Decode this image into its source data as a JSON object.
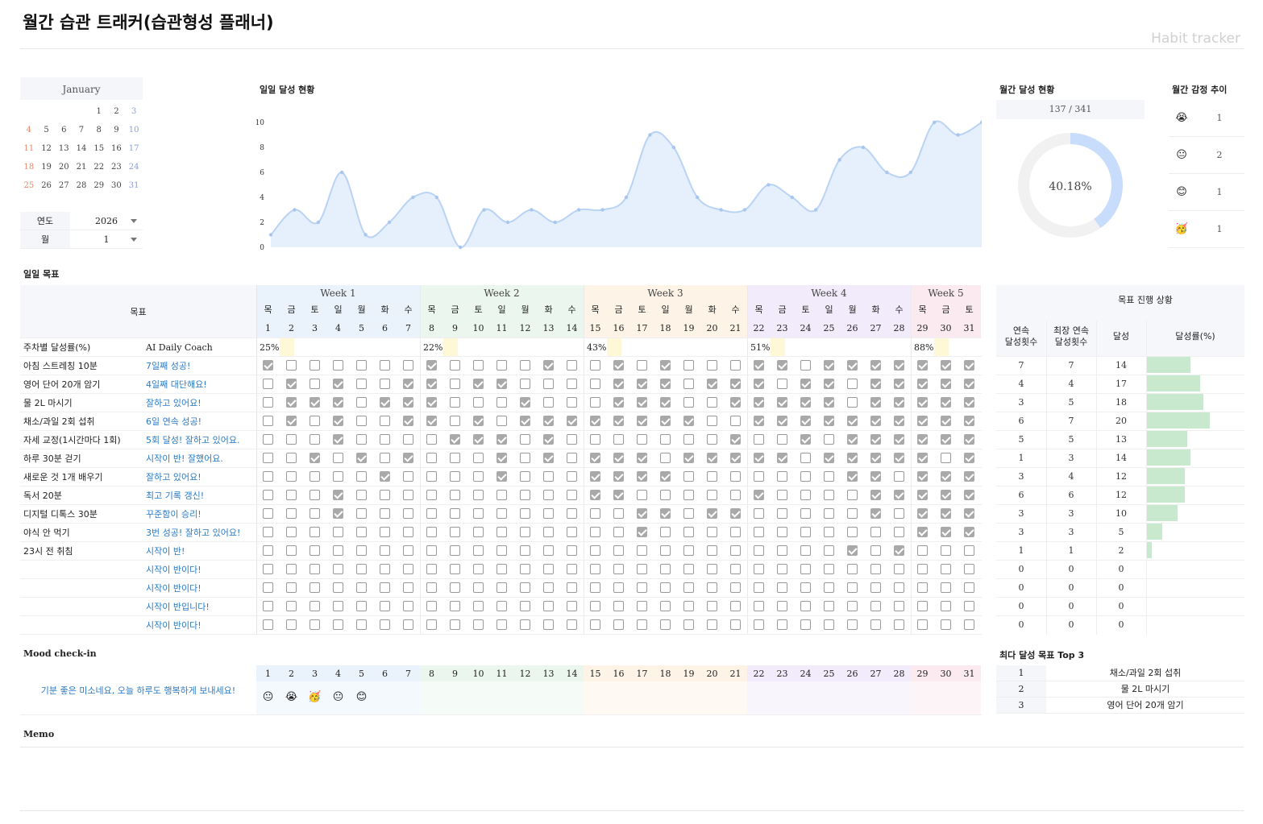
{
  "header": {
    "title": "월간 습관 트래커(습관형성 플래너)",
    "brand": "Habit tracker"
  },
  "calendar": {
    "month": "January",
    "days": [
      "",
      "",
      "",
      "",
      "1",
      "2",
      "3",
      "4",
      "5",
      "6",
      "7",
      "8",
      "9",
      "10",
      "11",
      "12",
      "13",
      "14",
      "15",
      "16",
      "17",
      "18",
      "19",
      "20",
      "21",
      "22",
      "23",
      "24",
      "25",
      "26",
      "27",
      "28",
      "29",
      "30",
      "31"
    ],
    "year_label": "연도",
    "year": "2026",
    "month_label": "월",
    "month_num": "1"
  },
  "daily_chart_title": "일일 달성 현황",
  "monthly_title": "월간 달성 현황",
  "monthly_count": "137 / 341",
  "monthly_percent": "40.18%",
  "monthly_fraction": 0.4018,
  "mood_trend_title": "월간 감정 추이",
  "mood_trend": [
    {
      "icon": "crying-face-icon",
      "emoji": "😭",
      "count": "1"
    },
    {
      "icon": "neutral-face-icon",
      "emoji": "😐",
      "count": "2"
    },
    {
      "icon": "smiling-face-icon",
      "emoji": "😊",
      "count": "1"
    },
    {
      "icon": "party-face-icon",
      "emoji": "🥳",
      "count": "1"
    }
  ],
  "chart_data": {
    "type": "area",
    "x": [
      1,
      2,
      3,
      4,
      5,
      6,
      7,
      8,
      9,
      10,
      11,
      12,
      13,
      14,
      15,
      16,
      17,
      18,
      19,
      20,
      21,
      22,
      23,
      24,
      25,
      26,
      27,
      28,
      29,
      30,
      31
    ],
    "values": [
      1,
      3,
      2,
      6,
      1,
      2,
      4,
      4,
      0,
      3,
      2,
      3,
      2,
      3,
      3,
      4,
      9,
      8,
      4,
      3,
      3,
      5,
      4,
      3,
      7,
      8,
      6,
      6,
      10,
      9,
      10
    ],
    "ylim": [
      0,
      10
    ],
    "yticks": [
      "0",
      "2",
      "4",
      "6",
      "8",
      "10"
    ],
    "color": "#b9d3f5",
    "fill": "#e6effc"
  },
  "daily_goals_title": "일일 목표",
  "goal_header": "목표",
  "weeks": [
    {
      "label": "Week 1",
      "color": "#eaf3fc",
      "days": [
        "1",
        "2",
        "3",
        "4",
        "5",
        "6",
        "7"
      ],
      "wd": [
        "목",
        "금",
        "토",
        "일",
        "월",
        "화",
        "수"
      ],
      "rate": "25%"
    },
    {
      "label": "Week 2",
      "color": "#ebf7ee",
      "days": [
        "8",
        "9",
        "10",
        "11",
        "12",
        "13",
        "14"
      ],
      "wd": [
        "목",
        "금",
        "토",
        "일",
        "월",
        "화",
        "수"
      ],
      "rate": "22%"
    },
    {
      "label": "Week 3",
      "color": "#fdf3e6",
      "days": [
        "15",
        "16",
        "17",
        "18",
        "19",
        "20",
        "21"
      ],
      "wd": [
        "목",
        "금",
        "토",
        "일",
        "월",
        "화",
        "수"
      ],
      "rate": "43%"
    },
    {
      "label": "Week 4",
      "color": "#f1ebfb",
      "days": [
        "22",
        "23",
        "24",
        "25",
        "26",
        "27",
        "28"
      ],
      "wd": [
        "목",
        "금",
        "토",
        "일",
        "월",
        "화",
        "수"
      ],
      "rate": "51%"
    },
    {
      "label": "Week 5",
      "color": "#fbeaf0",
      "days": [
        "29",
        "30",
        "31"
      ],
      "wd": [
        "목",
        "금",
        "토"
      ],
      "rate": "88%"
    }
  ],
  "weekly_rate_label": "주차별 달성률(%)",
  "coach_label": "AI Daily Coach",
  "goals": [
    {
      "name": "아침 스트레칭 10분",
      "coach": "7일째 성공!",
      "checks": "1000000100001001010001101111111"
    },
    {
      "name": "영어 단어 20개 암기",
      "coach": "4일째 대단해요!",
      "checks": "0101001101100001110111011011111"
    },
    {
      "name": "물 2L 마시기",
      "coach": "잘하고 있어요!",
      "checks": "0111011100010001110011111011111"
    },
    {
      "name": "채소/과일 2회 섭취",
      "coach": "6일 연속 성공!",
      "checks": "0101001101011111111001111111111"
    },
    {
      "name": "자세 교정(1시간마다 1회)",
      "coach": "5회 달성! 잘하고 있어요.",
      "checks": "0001000011101000000010010111111"
    },
    {
      "name": "하루 30분 걷기",
      "coach": "시작이 반! 잘했어요.",
      "checks": "0010101000101011101111101111101"
    },
    {
      "name": "새로운 것 1개 배우기",
      "coach": "잘하고 있어요!",
      "checks": "0000010000100011110000000110111"
    },
    {
      "name": "독서 20분",
      "coach": "최고 기록 갱신!",
      "checks": "0001000000000011000001000011111"
    },
    {
      "name": "디지털 디톡스 30분",
      "coach": "꾸준함이 승리!",
      "checks": "0001000000000000110110000010111"
    },
    {
      "name": "야식 안 먹기",
      "coach": "3번 성공! 잘하고 있어요!",
      "checks": "0000000000000000100000000000111"
    },
    {
      "name": "23시 전 취침",
      "coach": "시작이 반!",
      "checks": "0000000000000000000000000101000"
    },
    {
      "name": "",
      "coach": "시작이 반이다!",
      "checks": "0000000000000000000000000000000"
    },
    {
      "name": "",
      "coach": "시작이 반이다!",
      "checks": "0000000000000000000000000000000"
    },
    {
      "name": "",
      "coach": "시작이 반입니다!",
      "checks": "0000000000000000000000000000000"
    },
    {
      "name": "",
      "coach": "시작이 반이다!",
      "checks": "0000000000000000000000000000000"
    }
  ],
  "progress": {
    "title": "목표 진행 상황",
    "headers": [
      "연속\n달성횟수",
      "최장 연속\n달성횟수",
      "달성",
      "달성률(%)"
    ],
    "rows": [
      {
        "streak": "7",
        "best": "7",
        "done": "14",
        "rate": 0.45
      },
      {
        "streak": "4",
        "best": "4",
        "done": "17",
        "rate": 0.55
      },
      {
        "streak": "3",
        "best": "5",
        "done": "18",
        "rate": 0.58
      },
      {
        "streak": "6",
        "best": "7",
        "done": "20",
        "rate": 0.65
      },
      {
        "streak": "5",
        "best": "5",
        "done": "13",
        "rate": 0.42
      },
      {
        "streak": "1",
        "best": "3",
        "done": "14",
        "rate": 0.45
      },
      {
        "streak": "3",
        "best": "4",
        "done": "12",
        "rate": 0.39
      },
      {
        "streak": "6",
        "best": "6",
        "done": "12",
        "rate": 0.39
      },
      {
        "streak": "3",
        "best": "3",
        "done": "10",
        "rate": 0.32
      },
      {
        "streak": "3",
        "best": "3",
        "done": "5",
        "rate": 0.16
      },
      {
        "streak": "1",
        "best": "1",
        "done": "2",
        "rate": 0.06
      },
      {
        "streak": "0",
        "best": "0",
        "done": "0",
        "rate": 0
      },
      {
        "streak": "0",
        "best": "0",
        "done": "0",
        "rate": 0
      },
      {
        "streak": "0",
        "best": "0",
        "done": "0",
        "rate": 0
      },
      {
        "streak": "0",
        "best": "0",
        "done": "0",
        "rate": 0
      }
    ]
  },
  "mood_checkin": {
    "title": "Mood check-in",
    "message": "기분 좋은 미소네요, 오늘 하루도 행복하게 보내세요!",
    "moods": [
      "😐",
      "😭",
      "🥳",
      "😐",
      "😊",
      "",
      "",
      "",
      "",
      "",
      "",
      "",
      "",
      "",
      "",
      "",
      "",
      "",
      "",
      "",
      "",
      "",
      "",
      "",
      "",
      "",
      "",
      "",
      "",
      "",
      ""
    ]
  },
  "top3": {
    "title": "최다 달성 목표 Top 3",
    "rows": [
      {
        "rank": "1",
        "goal": "채소/과일 2회 섭취"
      },
      {
        "rank": "2",
        "goal": "물 2L 마시기"
      },
      {
        "rank": "3",
        "goal": "영어 단어 20개 암기"
      }
    ]
  },
  "memo_title": "Memo"
}
